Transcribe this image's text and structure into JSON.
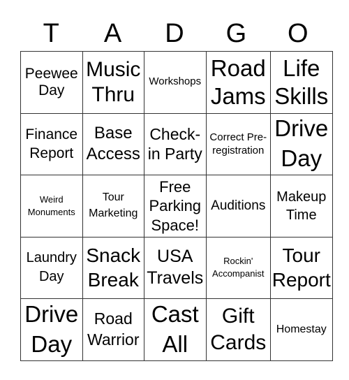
{
  "header": [
    "T",
    "A",
    "D",
    "G",
    "O"
  ],
  "rows": [
    [
      "Peewee Day",
      "Music Thru",
      "Workshops",
      "Road Jams",
      "Life Skills"
    ],
    [
      "Finance Report",
      "Base Access",
      "Check-in Party",
      "Correct Pre-registration",
      "Drive Day"
    ],
    [
      "Weird Monuments",
      "Tour Marketing",
      "Free Parking Space!",
      "Auditions",
      "Makeup Time"
    ],
    [
      "Laundry Day",
      "Snack Break",
      "USA Travels",
      "Rockin' Accompanist",
      "Tour Report"
    ],
    [
      "Drive Day",
      "Road Warrior",
      "Cast All",
      "Gift Cards",
      "Homestay"
    ]
  ]
}
